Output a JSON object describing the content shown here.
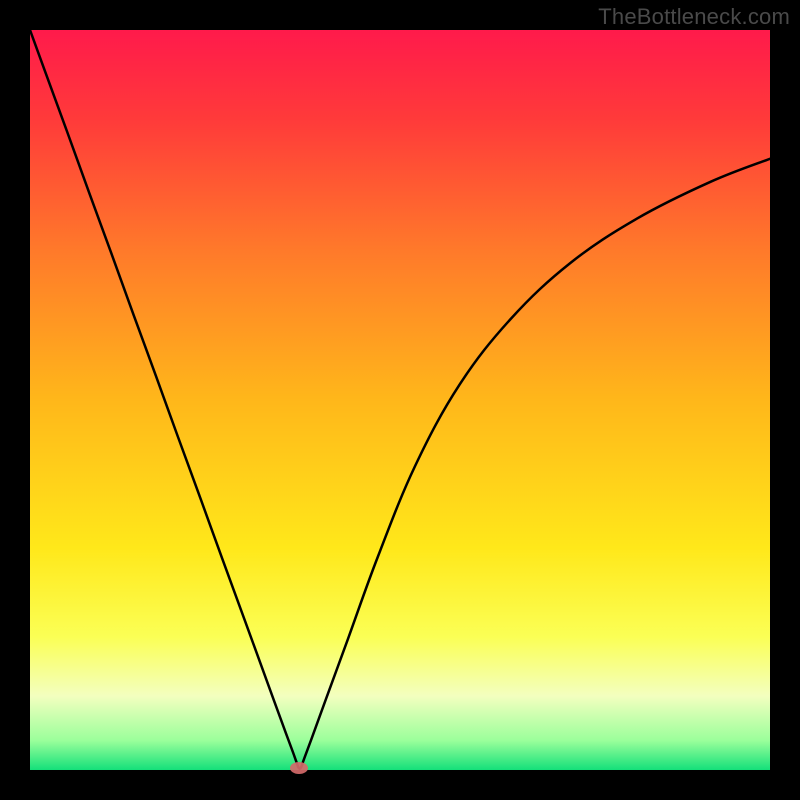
{
  "watermark": "TheBottleneck.com",
  "chart_data": {
    "type": "line",
    "title": "",
    "xlabel": "",
    "ylabel": "",
    "xlim": [
      0,
      100
    ],
    "ylim": [
      0,
      100
    ],
    "grid": false,
    "legend": false,
    "background_gradient": {
      "stops": [
        {
          "offset": 0.0,
          "color": "#ff1a4b"
        },
        {
          "offset": 0.12,
          "color": "#ff3a3a"
        },
        {
          "offset": 0.3,
          "color": "#ff7a2a"
        },
        {
          "offset": 0.5,
          "color": "#ffb71a"
        },
        {
          "offset": 0.7,
          "color": "#ffe81a"
        },
        {
          "offset": 0.82,
          "color": "#fbff55"
        },
        {
          "offset": 0.9,
          "color": "#f3ffbf"
        },
        {
          "offset": 0.96,
          "color": "#9bff9b"
        },
        {
          "offset": 1.0,
          "color": "#14e07a"
        }
      ]
    },
    "series": [
      {
        "name": "curve",
        "x": [
          0,
          2,
          5,
          8,
          11,
          14,
          17,
          20,
          23,
          26,
          29,
          31,
          33,
          34.5,
          35.5,
          36,
          36.3,
          36.6,
          37,
          38,
          40,
          43,
          47,
          52,
          58,
          65,
          73,
          82,
          92,
          100
        ],
        "y": [
          100,
          94.5,
          86.3,
          78.0,
          69.8,
          61.5,
          53.3,
          45.0,
          36.8,
          28.5,
          20.3,
          14.8,
          9.3,
          5.2,
          2.5,
          1.1,
          0.3,
          0.3,
          1.4,
          4.1,
          9.6,
          17.8,
          28.8,
          41.0,
          52.0,
          61.0,
          68.5,
          74.5,
          79.5,
          82.6
        ]
      }
    ],
    "annotations": [
      {
        "name": "min-marker",
        "x": 36.4,
        "y": 0.3,
        "color": "#d46a6a"
      }
    ]
  }
}
